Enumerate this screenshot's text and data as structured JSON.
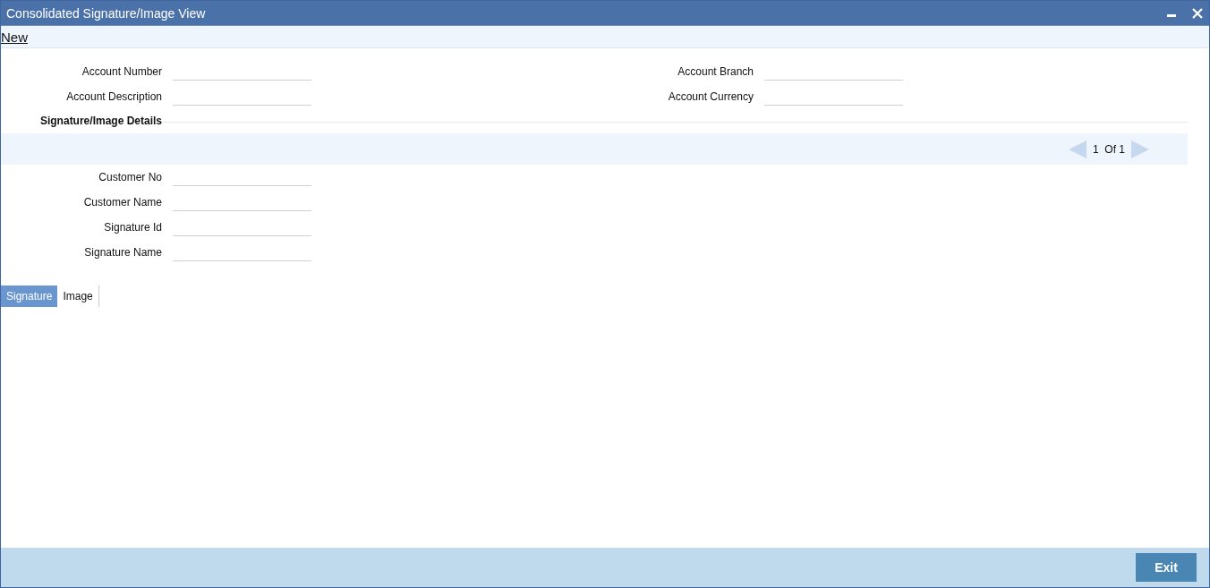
{
  "window": {
    "title": "Consolidated Signature/Image View"
  },
  "toolbar": {
    "new_link": "New"
  },
  "account_fields_left": [
    {
      "label": "Account Number"
    },
    {
      "label": "Account Description"
    }
  ],
  "account_fields_right": [
    {
      "label": "Account Branch"
    },
    {
      "label": "Account Currency"
    }
  ],
  "section": {
    "title": "Signature/Image Details",
    "pager": "1  Of 1"
  },
  "customer_fields": [
    {
      "label": "Customer No"
    },
    {
      "label": "Customer Name"
    },
    {
      "label": "Signature Id"
    },
    {
      "label": "Signature Name"
    }
  ],
  "tabs": [
    {
      "label": "Signature",
      "selected": true
    },
    {
      "label": "Image",
      "selected": false
    }
  ],
  "footer": {
    "button": "Exit"
  }
}
